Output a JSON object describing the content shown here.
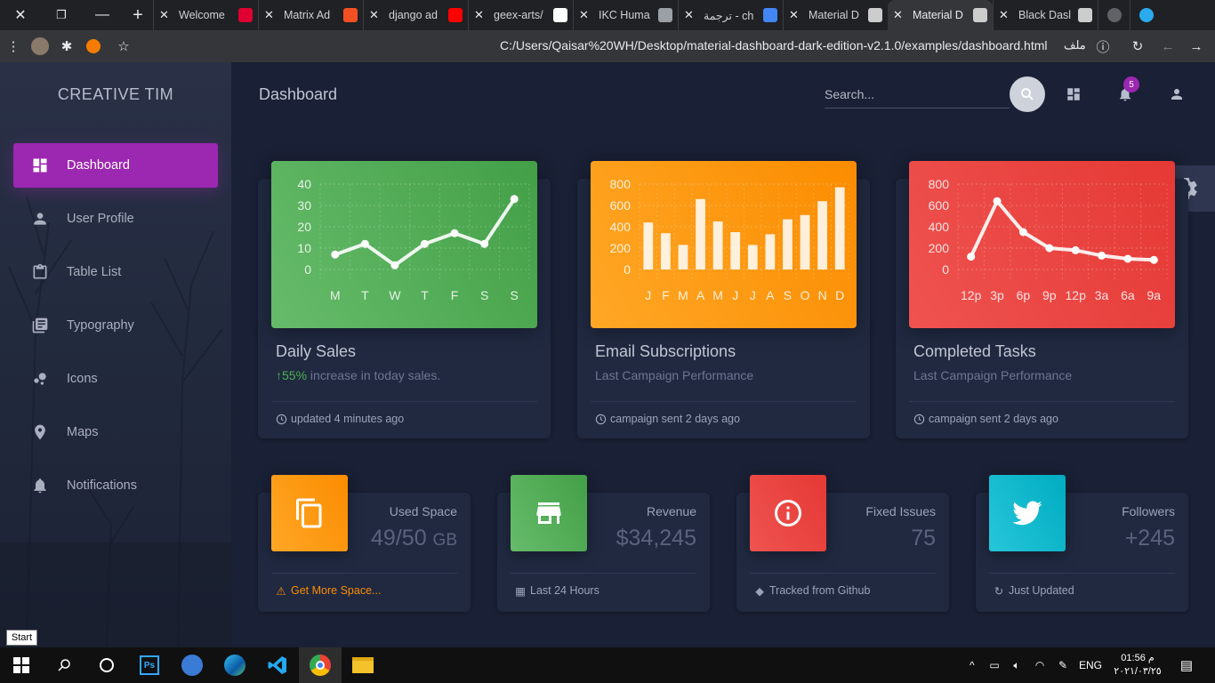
{
  "browser": {
    "tabs": [
      {
        "title": "Welcome",
        "icon": "angular-icon",
        "color": "#dd0031",
        "active": false
      },
      {
        "title": "Matrix Ad",
        "icon": "microsoft-icon",
        "color": "#f25022",
        "active": false
      },
      {
        "title": "django ad",
        "icon": "youtube-icon",
        "color": "#ff0000",
        "active": false
      },
      {
        "title": "geex-arts/",
        "icon": "github-icon",
        "color": "#ffffff",
        "active": false
      },
      {
        "title": "IKC Huma",
        "icon": "globe-icon",
        "color": "#9aa0a6",
        "active": false
      },
      {
        "title": "ترجمة - ch",
        "icon": "google-icon",
        "color": "#4285f4",
        "active": false
      },
      {
        "title": "Material D",
        "icon": "creative-tim-icon",
        "color": "#cccccc",
        "active": false
      },
      {
        "title": "Material D",
        "icon": "creative-tim-icon",
        "color": "#cccccc",
        "active": true
      },
      {
        "title": "Black Dasl",
        "icon": "creative-tim-icon",
        "color": "#cccccc",
        "active": false
      }
    ],
    "url": "C:/Users/Qaisar%20WH/Desktop/material-dashboard-dark-edition-v2.1.0/examples/dashboard.html",
    "url_prefix": "ملف"
  },
  "sidebar": {
    "brand": "CREATIVE TIM",
    "items": [
      {
        "label": "Dashboard",
        "icon": "dashboard-icon"
      },
      {
        "label": "User Profile",
        "icon": "person-icon"
      },
      {
        "label": "Table List",
        "icon": "clipboard-icon"
      },
      {
        "label": "Typography",
        "icon": "library-books-icon"
      },
      {
        "label": "Icons",
        "icon": "bubble-chart-icon"
      },
      {
        "label": "Maps",
        "icon": "location-icon"
      },
      {
        "label": "Notifications",
        "icon": "bell-icon"
      }
    ]
  },
  "header": {
    "title": "Dashboard",
    "search_placeholder": "Search...",
    "notification_count": "5"
  },
  "cards": [
    {
      "title": "Daily Sales",
      "sub_pct": "55%",
      "sub_text": " increase in today sales.",
      "footer": "updated 4 minutes ago",
      "color": "#43a047"
    },
    {
      "title": "Email Subscriptions",
      "sub_text": "Last Campaign Performance",
      "footer": "campaign sent 2 days ago",
      "color": "#fb8c00"
    },
    {
      "title": "Completed Tasks",
      "sub_text": "Last Campaign Performance",
      "footer": "campaign sent 2 days ago",
      "color": "#e53935"
    }
  ],
  "stats": [
    {
      "label": "Used Space",
      "value": "49/50",
      "unit": "GB",
      "footer": "Get More Space...",
      "icon": "copy-icon",
      "color": "#fb8c00"
    },
    {
      "label": "Revenue",
      "value": "$34,245",
      "footer": "Last 24 Hours",
      "icon": "store-icon",
      "color": "#43a047"
    },
    {
      "label": "Fixed Issues",
      "value": "75",
      "footer": "Tracked from Github",
      "icon": "info-icon",
      "color": "#e53935"
    },
    {
      "label": "Followers",
      "value": "+245",
      "footer": "Just Updated",
      "icon": "twitter-icon",
      "color": "#00acc1"
    }
  ],
  "chart_data": [
    {
      "type": "line",
      "categories": [
        "M",
        "T",
        "W",
        "T",
        "F",
        "S",
        "S"
      ],
      "values": [
        7,
        12,
        2,
        12,
        17,
        12,
        33
      ],
      "ylim": [
        0,
        40
      ],
      "yticks": [
        "0",
        "10",
        "20",
        "30",
        "40"
      ],
      "grid": true
    },
    {
      "type": "bar",
      "categories": [
        "J",
        "F",
        "M",
        "A",
        "M",
        "J",
        "J",
        "A",
        "S",
        "O",
        "N",
        "D"
      ],
      "values": [
        440,
        340,
        230,
        660,
        450,
        350,
        230,
        330,
        470,
        510,
        640,
        770
      ],
      "ylim": [
        0,
        800
      ],
      "yticks": [
        "0",
        "200",
        "400",
        "600",
        "800"
      ],
      "grid": true
    },
    {
      "type": "line",
      "categories": [
        "12p",
        "3p",
        "6p",
        "9p",
        "12p",
        "3a",
        "6a",
        "9a"
      ],
      "values": [
        120,
        640,
        350,
        200,
        180,
        130,
        100,
        90
      ],
      "ylim": [
        0,
        800
      ],
      "yticks": [
        "0",
        "200",
        "400",
        "600",
        "800"
      ],
      "grid": true
    }
  ],
  "taskbar": {
    "start_tooltip": "Start",
    "lang": "ENG",
    "time": "01:56 م",
    "date": "٢٠٢١/٠٣/٢٥"
  }
}
